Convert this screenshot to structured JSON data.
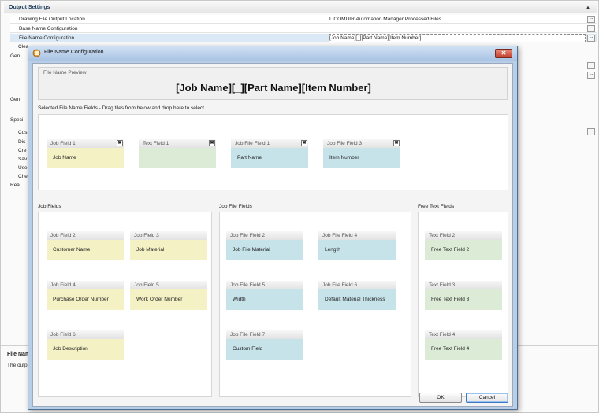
{
  "background": {
    "section_title": "Output Settings",
    "rows": [
      {
        "label": "Drawing File Output Location",
        "value": "LICOMDIR\\Automation Manager Processed Files"
      },
      {
        "label": "Base Name Configuration",
        "value": ""
      },
      {
        "label": "File Name Configuration",
        "value": "[Job Name][_][Part Name][Item Number]"
      }
    ],
    "fragments": {
      "clea": "Clea",
      "gen1": "Gen",
      "gen2": "Gen",
      "speci": "Speci",
      "cus": "Cus",
      "dis": "Dis",
      "cre": "Cre",
      "sav": "Sav",
      "use": "Use",
      "che": "Che",
      "rea": "Rea"
    },
    "ellipsis": "...",
    "bottom_title": "File Nam",
    "bottom_text": "The outp"
  },
  "dialog": {
    "title": "File Name Configuration",
    "close_glyph": "✕",
    "preview_label": "File Name Preview",
    "preview_value": "[Job Name][_][Part Name][Item Number]",
    "selected_label": "Selected File Name Fields - Drag tiles from below and drop here to select",
    "remove_glyph": "✖",
    "selected_tiles": [
      {
        "header": "Job Field 1",
        "body": "Job Name"
      },
      {
        "header": "Text Field 1",
        "body": "_"
      },
      {
        "header": "Job File Field 1",
        "body": "Part Name"
      },
      {
        "header": "Job File Field 3",
        "body": "Item Number"
      }
    ],
    "groups": {
      "job_fields": {
        "label": "Job Fields",
        "tiles": [
          {
            "header": "Job Field 2",
            "body": "Customer Name"
          },
          {
            "header": "Job Field 3",
            "body": "Job Material"
          },
          {
            "header": "Job Field 4",
            "body": "Purchase Order Number"
          },
          {
            "header": "Job Field 5",
            "body": "Work Order Number"
          },
          {
            "header": "Job Field 6",
            "body": "Job Description"
          }
        ]
      },
      "job_file_fields": {
        "label": "Job File Fields",
        "tiles": [
          {
            "header": "Job File Field 2",
            "body": "Job File Material"
          },
          {
            "header": "Job File Field 4",
            "body": "Length"
          },
          {
            "header": "Job File Field 5",
            "body": "Width"
          },
          {
            "header": "Job File Field 6",
            "body": "Default Material Thickness"
          },
          {
            "header": "Job File Field 7",
            "body": "Custom Field"
          }
        ]
      },
      "free_text_fields": {
        "label": "Free Text Fields",
        "tiles": [
          {
            "header": "Text Field 2",
            "body": "Free Text Field 2"
          },
          {
            "header": "Text Field 3",
            "body": "Free Text Field 3"
          },
          {
            "header": "Text Field 4",
            "body": "Free Text Field 4"
          }
        ]
      }
    },
    "ok_label": "OK",
    "cancel_label": "Cancel"
  },
  "colors": {
    "job_tile": "#f4f2c4",
    "text_tile": "#dcebd6",
    "job_file_tile": "#c7e3ea",
    "dialog_frame": "#b8cde6"
  }
}
